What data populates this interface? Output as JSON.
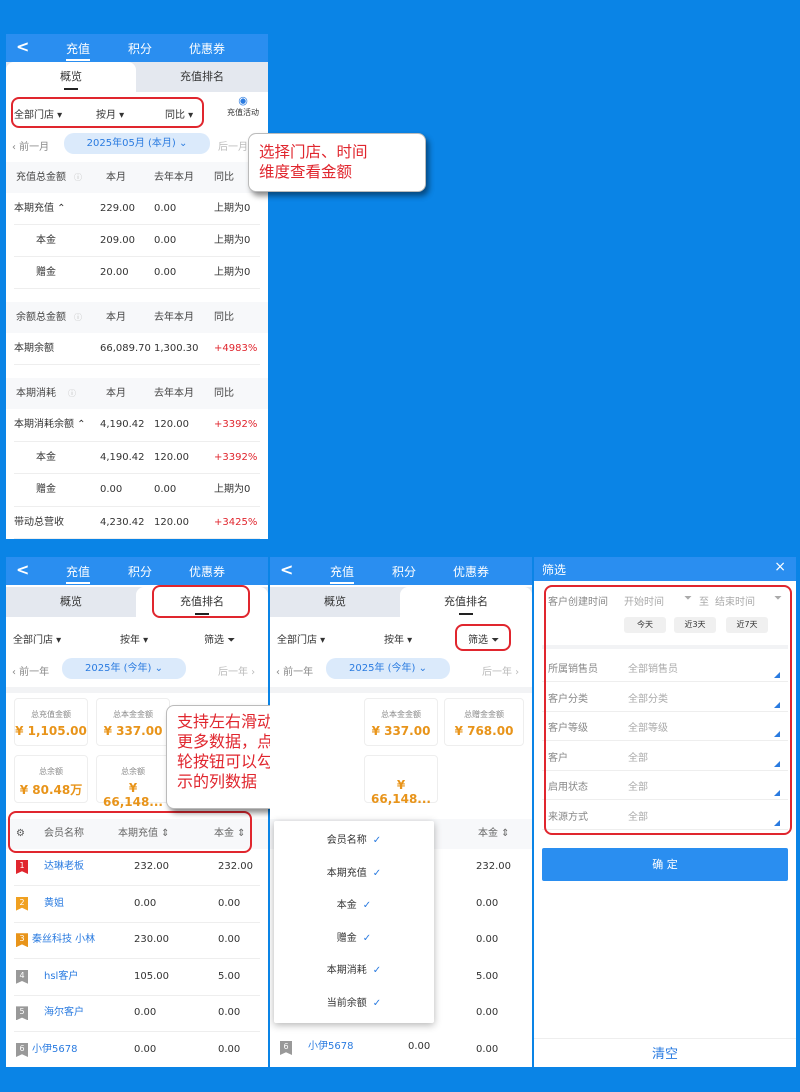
{
  "nav": {
    "back": "<",
    "tab1": "充值",
    "tab2": "积分",
    "tab3": "优惠券"
  },
  "segments": {
    "overview": "概览",
    "ranking": "充值排名"
  },
  "p1": {
    "store": "全部门店",
    "period": "按月",
    "compare": "同比",
    "activity": "充值活动",
    "prev": "‹ 前一月",
    "current": "2025年05月 (本月) ⌄",
    "next": "后一月",
    "callout": [
      "选择门店、时间",
      "维度查看金额"
    ],
    "sec1": {
      "h": [
        "充值总金额",
        "本月",
        "去年本月",
        "同比"
      ],
      "rows": [
        [
          "本期充值  ⌃",
          "229.00",
          "0.00",
          "上期为0"
        ],
        [
          "本金",
          "209.00",
          "0.00",
          "上期为0"
        ],
        [
          "赠金",
          "20.00",
          "0.00",
          "上期为0"
        ]
      ]
    },
    "sec2": {
      "h": [
        "余额总金额",
        "本月",
        "去年本月",
        "同比"
      ],
      "rows": [
        [
          "本期余额",
          "66,089.70",
          "1,300.30",
          "+4983%"
        ]
      ]
    },
    "sec3": {
      "h": [
        "本期消耗",
        "本月",
        "去年本月",
        "同比"
      ],
      "rows": [
        [
          "本期消耗余额  ⌃",
          "4,190.42",
          "120.00",
          "+3392%"
        ],
        [
          "本金",
          "4,190.42",
          "120.00",
          "+3392%"
        ],
        [
          "赠金",
          "0.00",
          "0.00",
          "上期为0"
        ],
        [
          "带动总营收",
          "4,230.42",
          "120.00",
          "+3425%"
        ]
      ]
    }
  },
  "p2": {
    "store": "全部门店",
    "period": "按年",
    "filter": "筛选",
    "prev": "‹ 前一年",
    "current": "2025年 (今年) ⌄",
    "next": "后一年 ›",
    "cards": [
      [
        "总充值金额",
        "¥ 1,105.00"
      ],
      [
        "总本金金额",
        "¥ 337.00"
      ],
      [
        "总余额",
        "¥ 80.48万"
      ],
      [
        "总余额",
        "¥ 66,148..."
      ]
    ],
    "callout": [
      "支持左右滑动查看",
      "更多数据，点击齿",
      "轮按钮可以勾选显",
      "示的列数据"
    ],
    "th": [
      "会员名称",
      "本期充值 ⇕",
      "本金 ⇕"
    ],
    "rows": [
      [
        "1",
        "达琳老板",
        "232.00",
        "232.00"
      ],
      [
        "2",
        "黄姐",
        "0.00",
        "0.00"
      ],
      [
        "3",
        "秦丝科技 小林",
        "230.00",
        "0.00"
      ],
      [
        "4",
        "hsl客户",
        "105.00",
        "5.00"
      ],
      [
        "5",
        "海尔客户",
        "0.00",
        "0.00"
      ],
      [
        "6",
        "小伊5678",
        "0.00",
        "0.00"
      ]
    ]
  },
  "p3": {
    "store": "全部门店",
    "period": "按年",
    "filter": "筛选",
    "prev": "‹ 前一年",
    "current": "2025年 (今年) ⌄",
    "next": "后一年 ›",
    "cards": [
      [
        "总本金金额",
        "¥ 337.00"
      ],
      [
        "总赠金金额",
        "¥ 768.00"
      ],
      [
        "¥ 66,148..."
      ]
    ],
    "th": "本金 ⇕",
    "cols": [
      "会员名称",
      "本期充值",
      "本金",
      "赠金",
      "本期消耗",
      "当前余额"
    ],
    "vals": [
      "232.00",
      "0.00",
      "0.00",
      "5.00",
      "0.00",
      "0.00"
    ],
    "last": [
      "6",
      "小伊5678",
      "0.00"
    ]
  },
  "p4": {
    "title": "筛选",
    "close": "×",
    "created": "客户创建时间",
    "start": "开始时间",
    "to": "至",
    "end": "结束时间",
    "quick": [
      "今天",
      "近3天",
      "近7天"
    ],
    "fields": [
      [
        "所属销售员",
        "全部销售员"
      ],
      [
        "客户分类",
        "全部分类"
      ],
      [
        "客户等级",
        "全部等级"
      ],
      [
        "客户",
        "全部"
      ],
      [
        "启用状态",
        "全部"
      ],
      [
        "来源方式",
        "全部"
      ]
    ],
    "confirm": "确 定",
    "clear": "清空"
  },
  "colors": {
    "accent": "#2a8ef0",
    "highlight": "#e0262e",
    "background": "#0a84e6"
  }
}
